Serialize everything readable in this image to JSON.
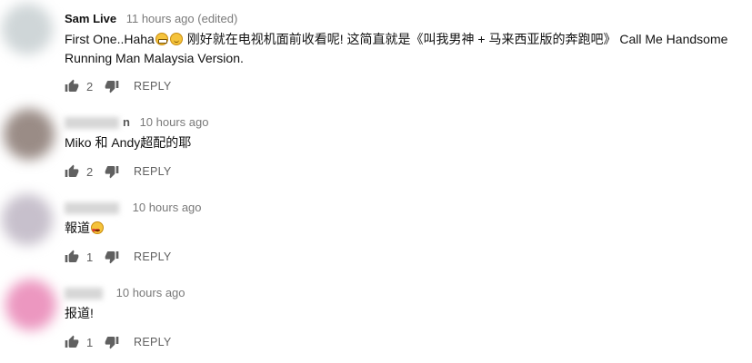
{
  "comments": [
    {
      "author": "Sam Live",
      "time": "11 hours ago (edited)",
      "text_part1": "First One..Haha",
      "text_part2": " 刚好就在电视机面前收看呢! 这简直就是《叫我男神 + 马来西亚版的奔跑吧》 Call Me Handsome Running Man Malaysia Version.",
      "emojis": [
        "grimacing-face-emoji",
        "slightly-smiling-face-emoji"
      ],
      "likes": "2",
      "reply_label": "REPLY",
      "avatar_color": "#cfd6d8"
    },
    {
      "author_visible": "n",
      "time": "10 hours ago",
      "text": "Miko 和 Andy超配的耶",
      "likes": "2",
      "reply_label": "REPLY",
      "avatar_color": "#9a8c86"
    },
    {
      "author_visible": "",
      "time": "10 hours ago",
      "text": "報道",
      "emojis": [
        "heart-eyes-emoji"
      ],
      "likes": "1",
      "reply_label": "REPLY",
      "avatar_color": "#c7c0cc"
    },
    {
      "author_visible": "",
      "time": "10 hours ago",
      "text": "报道!",
      "likes": "1",
      "reply_label": "REPLY",
      "avatar_color": "#ec97c0"
    }
  ],
  "colors": {
    "text": "#111111",
    "secondary": "#606060",
    "timestamp": "#7a7a7a",
    "emoji_yellow": "#f5c33b"
  }
}
